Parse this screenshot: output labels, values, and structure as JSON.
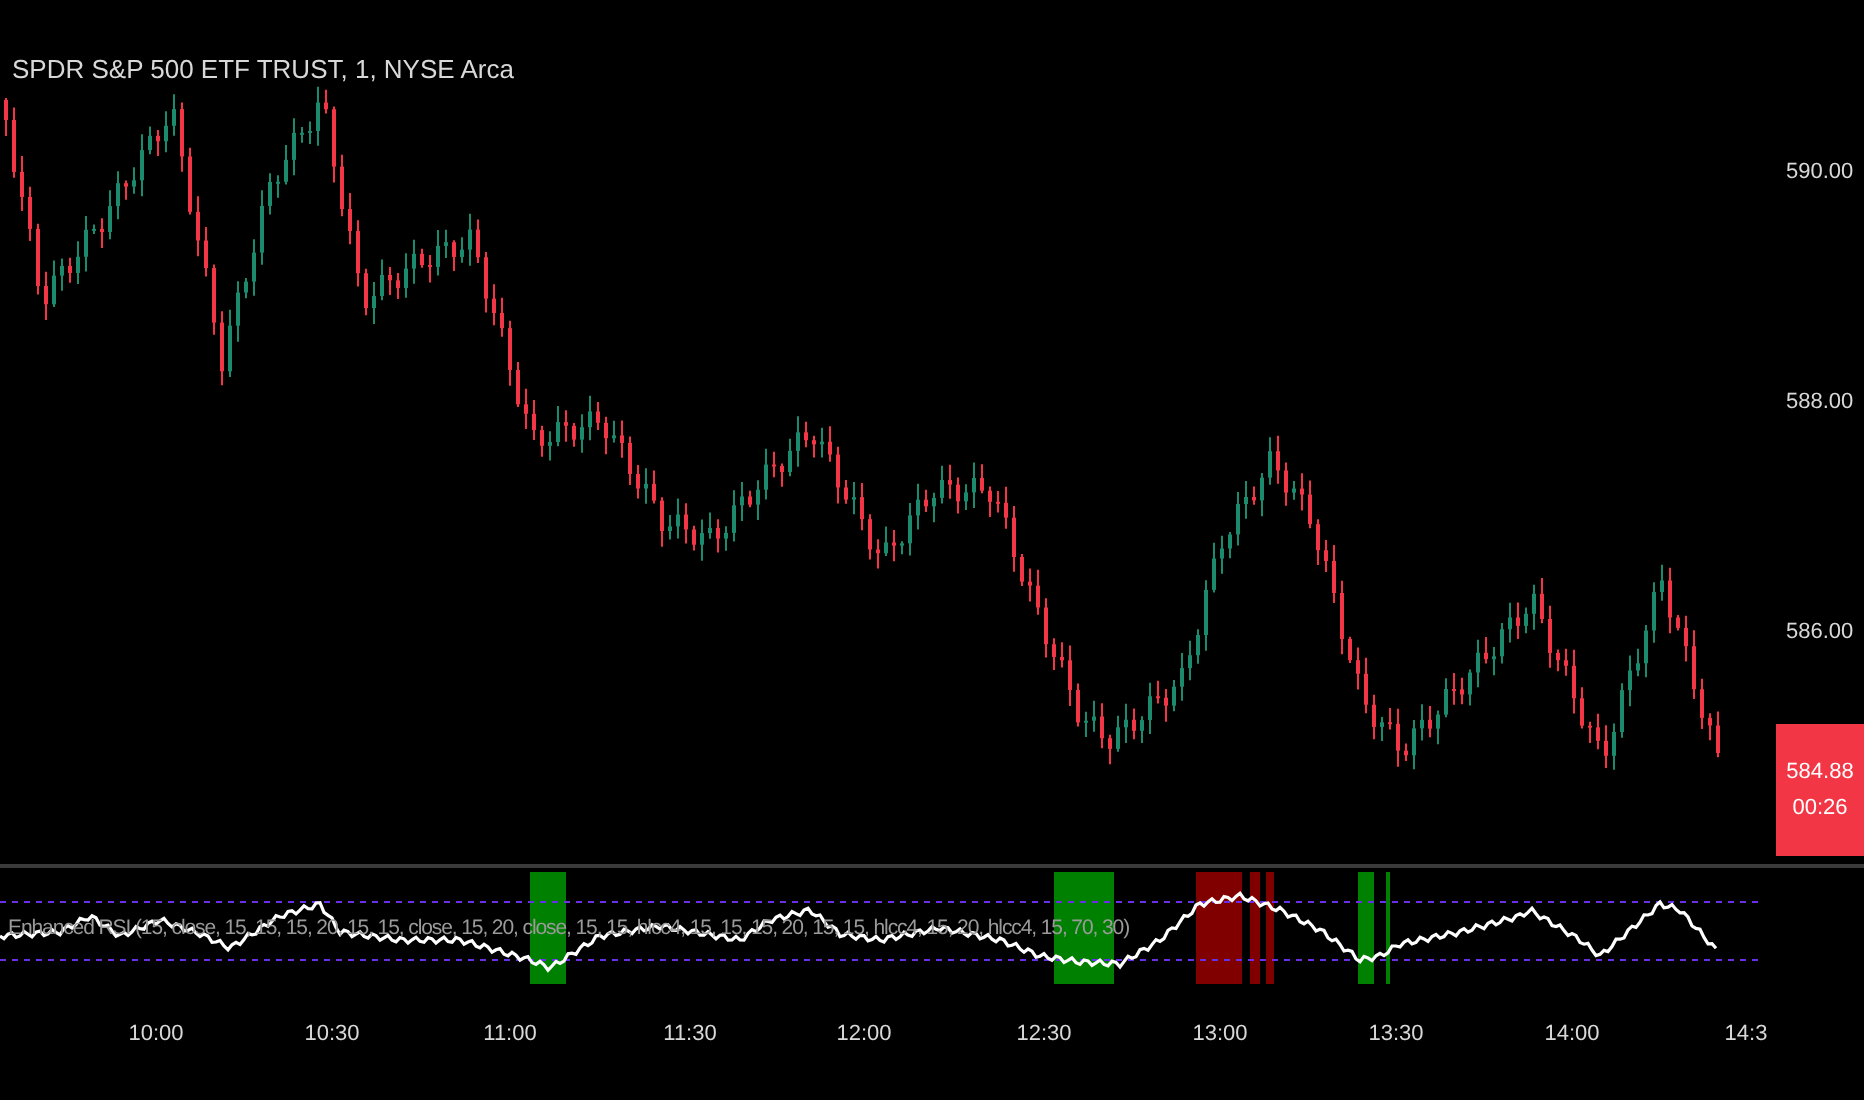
{
  "chart_title": "SPDR S&P 500 ETF TRUST, 1, NYSE Arca",
  "price_axis": [
    "590.00",
    "588.00",
    "586.00"
  ],
  "last_price": {
    "price": "584.88",
    "countdown": "00:26"
  },
  "indicator": {
    "label": "Enhanced RSI (15, close, 15, 15, 15, 20, 15, 15, close, 15, 20, close, 15, 15, hlcc4, 15, 15, 15, 20, 15, 15, hlcc4, 15, 20, hlcc4, 15, 70, 30)"
  },
  "time_axis": [
    "10:00",
    "10:30",
    "11:00",
    "11:30",
    "12:00",
    "12:30",
    "13:00",
    "13:30",
    "14:00",
    "14:3"
  ]
}
